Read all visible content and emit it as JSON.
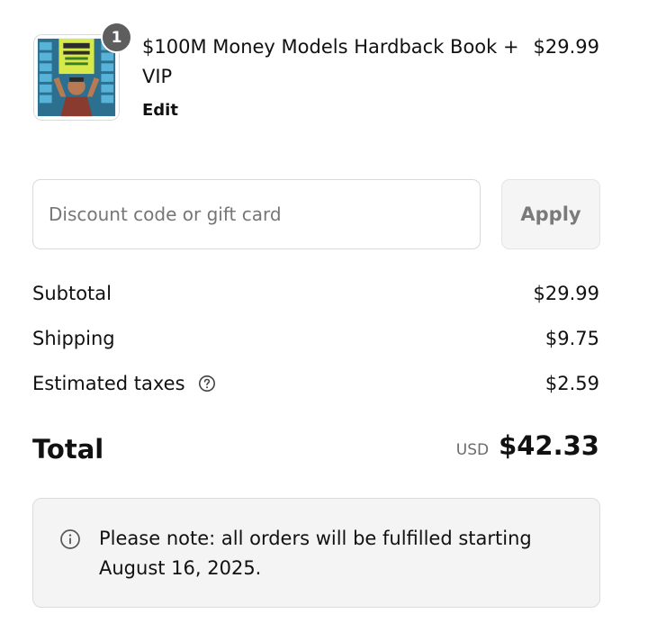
{
  "product": {
    "quantity": "1",
    "title": "$100M Money Models Hardback Book + VIP",
    "price": "$29.99",
    "edit_label": "Edit",
    "image_icon": "book-cover-image"
  },
  "discount": {
    "placeholder": "Discount code or gift card",
    "value": "",
    "apply_label": "Apply"
  },
  "summary": {
    "subtotal_label": "Subtotal",
    "subtotal_value": "$29.99",
    "shipping_label": "Shipping",
    "shipping_value": "$9.75",
    "taxes_label": "Estimated taxes",
    "taxes_value": "$2.59",
    "taxes_icon": "question-circle-icon"
  },
  "total": {
    "label": "Total",
    "currency": "USD",
    "value": "$42.33"
  },
  "note": {
    "icon": "info-icon",
    "text": "Please note: all orders will be fulfilled starting August 16, 2025."
  },
  "colors": {
    "text": "#111111",
    "muted": "#767676",
    "border": "#d9d9d9",
    "note_bg": "#f4f4f4",
    "badge_bg": "#5e5e5e"
  }
}
